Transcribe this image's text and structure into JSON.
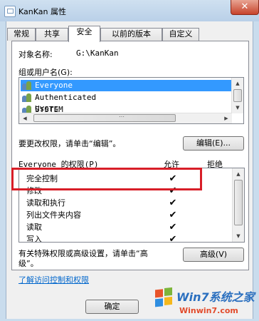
{
  "window": {
    "title": "KanKan 属性",
    "close": "✕"
  },
  "tabs": [
    "常规",
    "共享",
    "安全",
    "以前的版本",
    "自定义"
  ],
  "object": {
    "label": "对象名称:",
    "value": "G:\\KanKan"
  },
  "groups": {
    "label": "组或用户名(G):",
    "items": [
      "Everyone",
      "Authenticated Users",
      "SYSTEM",
      "…"
    ],
    "selected": 0
  },
  "edit": {
    "text": "要更改权限，请单击“编辑”。",
    "button": "编辑(E)..."
  },
  "perms": {
    "header": "Everyone 的权限(P)",
    "allow": "允许",
    "deny": "拒绝",
    "rows": [
      {
        "name": "完全控制",
        "allow": "✔"
      },
      {
        "name": "修改",
        "allow": "✔"
      },
      {
        "name": "读取和执行",
        "allow": "✔"
      },
      {
        "name": "列出文件夹内容",
        "allow": "✔"
      },
      {
        "name": "读取",
        "allow": "✔"
      },
      {
        "name": "写入",
        "allow": "✔"
      }
    ]
  },
  "advanced": {
    "text_line1": "有关特殊权限或高级设置，请单击“高",
    "text_line2": "级”。",
    "button": "高级(V)"
  },
  "learn_link": "了解访问控制和权限",
  "ok": "确定",
  "watermark": {
    "logo": "Win7系统之家",
    "url": "Winwin7.com"
  },
  "colors": {
    "highlight": "#d81e28",
    "selection": "#3399ff",
    "link": "#0066cc",
    "close": "#c7432b"
  }
}
